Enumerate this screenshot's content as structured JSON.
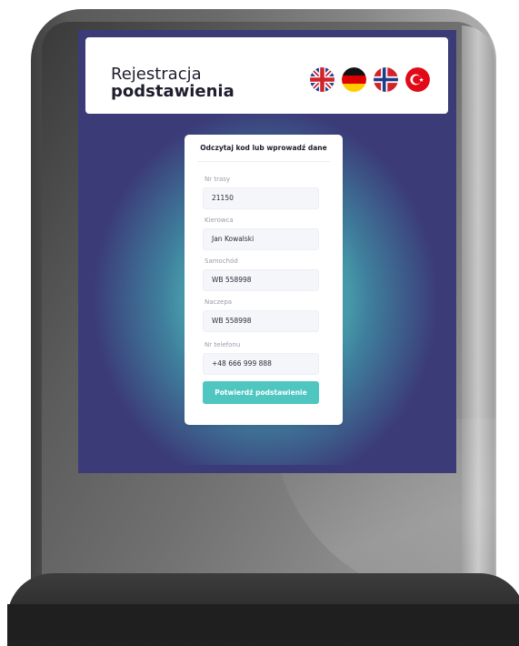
{
  "header": {
    "title_line1": "Rejestracja",
    "title_line2": "podstawienia",
    "languages": [
      {
        "code": "en",
        "icon": "flag-uk-icon"
      },
      {
        "code": "de",
        "icon": "flag-germany-icon"
      },
      {
        "code": "no",
        "icon": "flag-norway-icon"
      },
      {
        "code": "tr",
        "icon": "flag-turkey-icon"
      }
    ]
  },
  "form": {
    "title": "Odczytaj kod lub wprowadź dane",
    "fields": [
      {
        "label": "Nr trasy",
        "value": "21150"
      },
      {
        "label": "Kierowca",
        "value": "Jan Kowalski"
      },
      {
        "label": "Samochód",
        "value": "WB 558998"
      },
      {
        "label": "Naczepa",
        "value": "WB 558998"
      },
      {
        "label": "Nr telefonu",
        "value": "+48 666 999 888"
      }
    ],
    "submit_label": "Potwierdź podstawienie"
  },
  "colors": {
    "screen_background": "#3b3b78",
    "glow": "#5cc7bf",
    "accent_button": "#4fc6c0",
    "kiosk_frame": "#5a5a5a"
  }
}
